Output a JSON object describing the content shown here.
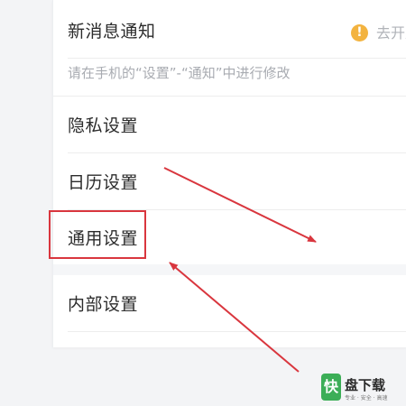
{
  "notification": {
    "title": "新消息通知",
    "status": "去开启",
    "hint": "请在手机的“设置”-“通知”中进行修改"
  },
  "settings": {
    "items": [
      {
        "label": "隐私设置"
      },
      {
        "label": "日历设置"
      },
      {
        "label": "通用设置"
      },
      {
        "label": "内部设置"
      }
    ]
  },
  "annotation": {
    "highlight_color": "#d9363e",
    "arrow_color": "#d9363e"
  },
  "watermark": {
    "icon_text": "快",
    "title": "盘下载",
    "subtitle": "专业 · 安全 · 高速"
  }
}
